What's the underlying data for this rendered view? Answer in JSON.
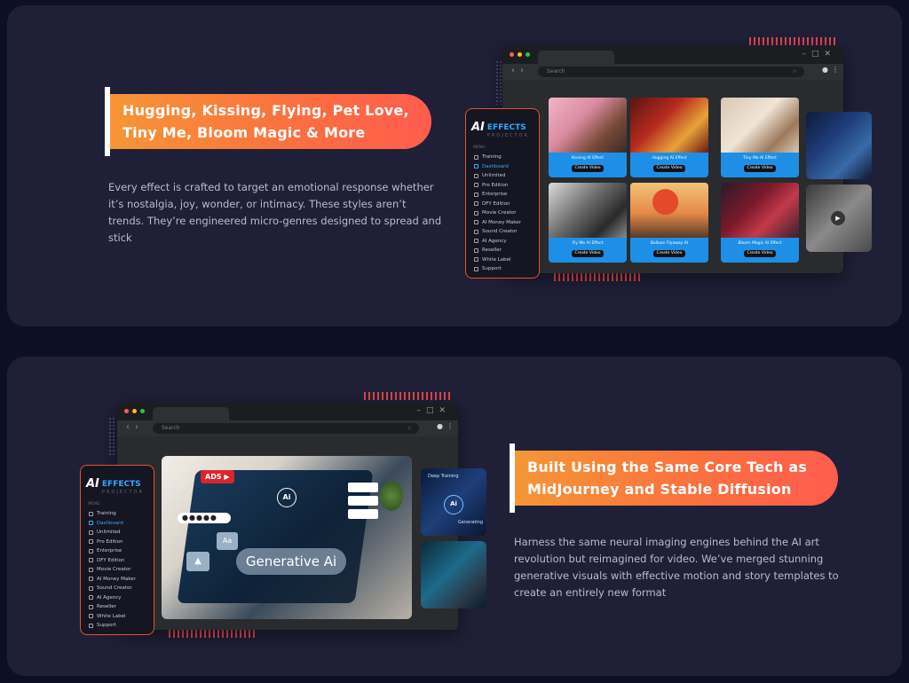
{
  "section1": {
    "headline": [
      "Hugging, Kissing, Flying, Pet Love,",
      "Tiny Me, Bloom Magic & More"
    ],
    "description": "Every effect is crafted to target an emotional response whether it’s nostalgia, joy, wonder, or intimacy. These styles aren’t trends. They’re engineered micro-genres designed to spread and stick"
  },
  "section2": {
    "headline": [
      "Built Using the Same Core Tech as",
      "MidJourney and Stable Diffusion"
    ],
    "description": "Harness the same neural imaging engines behind the AI art revolution but reimagined for video. We’ve merged stunning generative visuals with effective motion and story templates to create an entirely new format",
    "hero_labels": {
      "ads": "ADS",
      "generative": "Generative Ai",
      "ai": "Ai",
      "aa": "Aa"
    },
    "thumb_labels": {
      "deep_training": "Deep Training",
      "generating": "Generating"
    }
  },
  "browser": {
    "search_placeholder": "Search"
  },
  "app": {
    "logo_ai": "AI",
    "logo_effects": "EFFECTS",
    "logo_sub": "PROJECTOR",
    "menu_label": "MENU",
    "menu_items": [
      "Training",
      "Dashboard",
      "Unlimited",
      "Pro Edition",
      "Enterprise",
      "DFY Edition",
      "Movie Creator",
      "AI Money Maker",
      "Sound Creator",
      "AI Agency",
      "Reseller",
      "White Label",
      "Support"
    ],
    "active_item": "Dashboard"
  },
  "effects": [
    {
      "title": "Kissing AI Effect",
      "button": "Create Video"
    },
    {
      "title": "Hugging AI Effect",
      "button": "Create Video"
    },
    {
      "title": "Tiny Me AI Effect",
      "button": "Create Video"
    },
    {
      "title": "Fly Me AI Effect",
      "button": "Create Video"
    },
    {
      "title": "Balloon Flyaway AI",
      "button": "Create Video"
    },
    {
      "title": "Bloom Magic AI Effect",
      "button": "Create Video"
    }
  ],
  "colors": {
    "card_bg": "#1f2038",
    "page_bg": "#0d0f24",
    "accent_orange": "#f59636",
    "accent_red": "#ff5c4e",
    "accent_blue": "#1e8fe6"
  }
}
